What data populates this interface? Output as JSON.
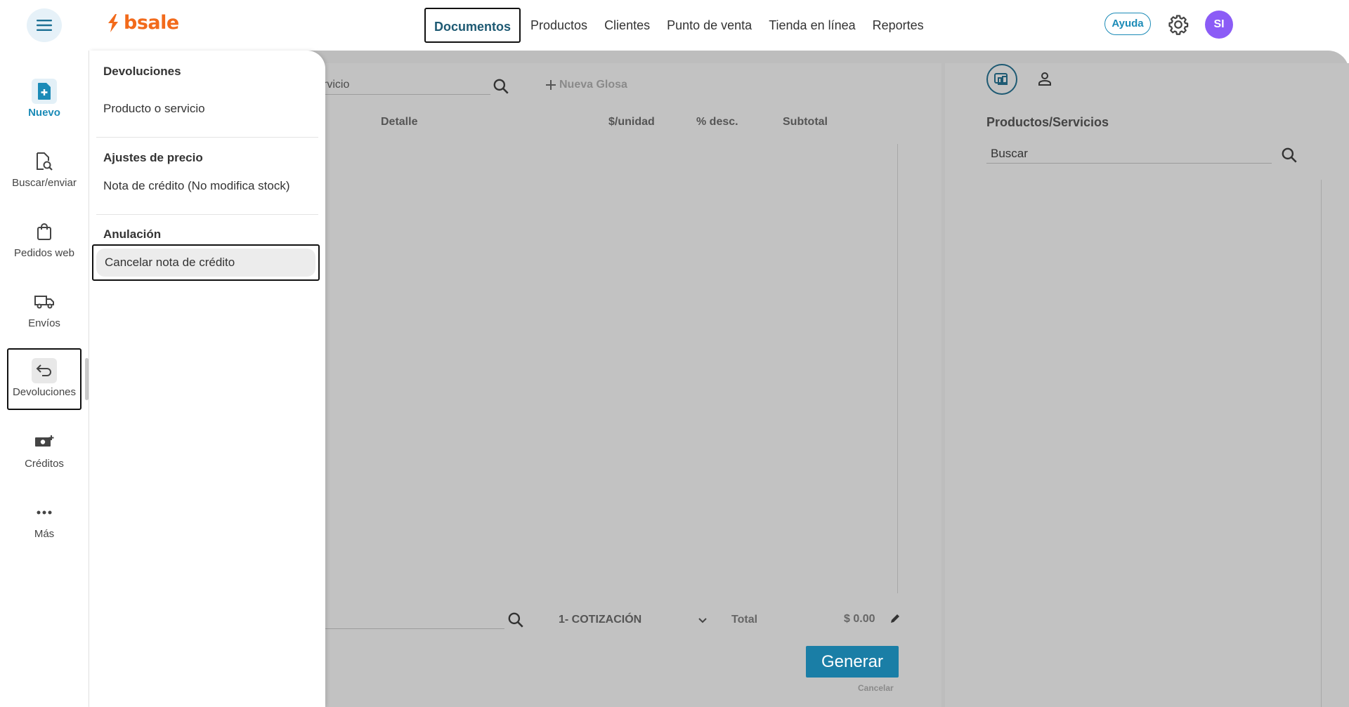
{
  "header": {
    "logo_text": "bsale",
    "nav": [
      "Documentos",
      "Productos",
      "Clientes",
      "Punto de venta",
      "Tienda en línea",
      "Reportes"
    ],
    "active_nav": "Documentos",
    "help_label": "Ayuda",
    "avatar_initials": "SI",
    "colors": {
      "brand": "#f26a1b",
      "accent": "#1b8bb7",
      "avatar": "#8b5cf6"
    }
  },
  "rail": {
    "items": [
      {
        "label": "Nuevo",
        "icon": "file-plus-icon"
      },
      {
        "label": "Buscar/enviar",
        "icon": "file-search-icon"
      },
      {
        "label": "Pedidos web",
        "icon": "shopping-bag-icon"
      },
      {
        "label": "Envíos",
        "icon": "truck-icon"
      },
      {
        "label": "Devoluciones",
        "icon": "return-arrow-icon"
      },
      {
        "label": "Créditos",
        "icon": "cash-plus-icon"
      },
      {
        "label": "Más",
        "icon": "more-dots-icon"
      }
    ],
    "selected": "Devoluciones"
  },
  "menu": {
    "sections": [
      {
        "title": "Devoluciones",
        "items": [
          "Producto o servicio"
        ]
      },
      {
        "title": "Ajustes de precio",
        "items": [
          "Nota de crédito (No modifica stock)"
        ]
      },
      {
        "title": "Anulación",
        "items": [
          "Cancelar nota de crédito"
        ]
      }
    ],
    "selected_item": "Cancelar nota de crédito"
  },
  "document": {
    "search_value": "rvicio",
    "new_glosa": "Nueva Glosa",
    "columns": [
      "Detalle",
      "$/unidad",
      "% desc.",
      "Subtotal"
    ],
    "doc_type": "1- COTIZACIÓN",
    "total_label": "Total",
    "total_value": "$ 0.00",
    "generate_label": "Generar",
    "cancel_label": "Cancelar"
  },
  "right_panel": {
    "title": "Productos/Servicios",
    "search_placeholder": "Buscar"
  }
}
